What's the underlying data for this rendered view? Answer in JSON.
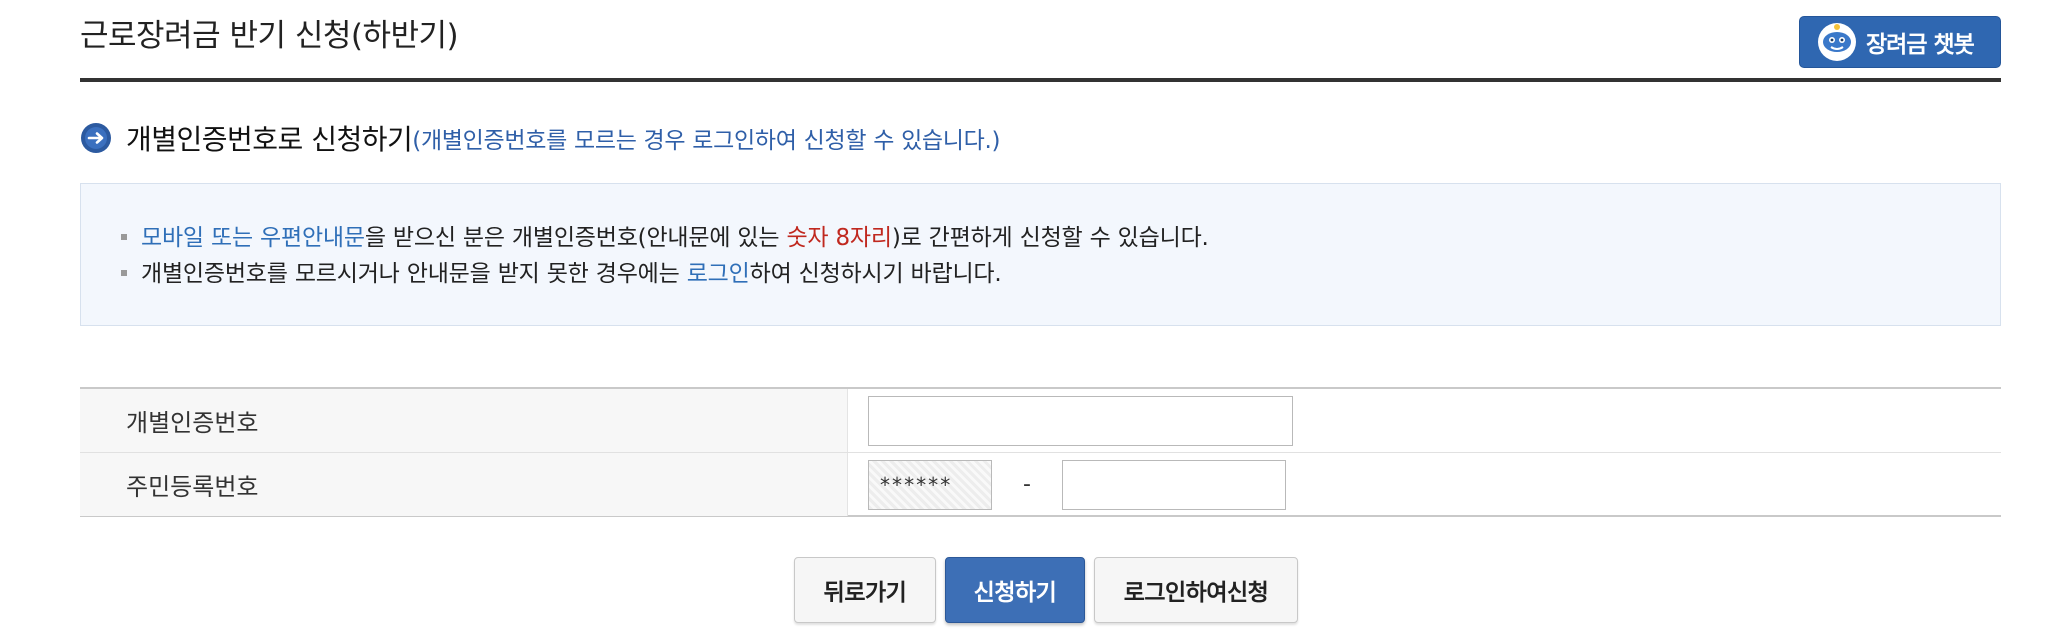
{
  "header": {
    "title": "근로장려금 반기 신청(하반기)",
    "chatbot_label": "장려금 챗봇"
  },
  "section": {
    "title": "개별인증번호로 신청하기",
    "note": "(개별인증번호를 모르는 경우 로그인하여 신청할 수 있습니다.)"
  },
  "notice": {
    "line1": {
      "part1": "모바일 또는 우편안내문",
      "part2": "을 받으신 분은 개별인증번호(안내문에 있는 ",
      "part3": "숫자 8자리",
      "part4": ")로 간편하게 신청할 수 있습니다."
    },
    "line2": {
      "part1": "개별인증번호를 모르시거나 안내문을 받지 못한 경우에는 ",
      "part2": "로그인",
      "part3": "하여 신청하시기 바랍니다."
    }
  },
  "form": {
    "cert_label": "개별인증번호",
    "cert_value": "",
    "rrn_label": "주민등록번호",
    "rrn_front_value": "******",
    "rrn_separator": "-",
    "rrn_back_value": ""
  },
  "buttons": {
    "back": "뒤로가기",
    "apply": "신청하기",
    "login_apply": "로그인하여신청"
  },
  "colors": {
    "primary_blue": "#2f67b1",
    "link_blue": "#2f6fb8",
    "highlight_red": "#c0281f",
    "notice_bg": "#f3f7fd"
  },
  "icons": {
    "chatbot": "chatbot-mascot-icon",
    "section": "arrow-circle-icon"
  }
}
